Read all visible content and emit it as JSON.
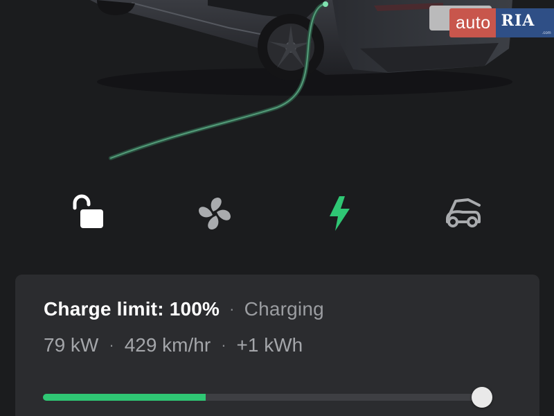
{
  "watermark": {
    "auto": "auto",
    "ria": "RIA",
    "domain": ".com"
  },
  "controls": {
    "lock": {
      "icon": "unlock-icon"
    },
    "climate": {
      "icon": "fan-icon"
    },
    "charging": {
      "icon": "lightning-bolt-icon",
      "color": "#2fc774"
    },
    "frunk": {
      "icon": "frunk-icon"
    }
  },
  "charge": {
    "limit_label": "Charge limit: 100%",
    "separator": "·",
    "status": "Charging",
    "power": "79 kW",
    "rate": "429 km/hr",
    "energy_added": "+1 kWh",
    "current_level_fraction": 0.37,
    "limit_fraction": 1.0,
    "fill_color": "#2fc774"
  }
}
